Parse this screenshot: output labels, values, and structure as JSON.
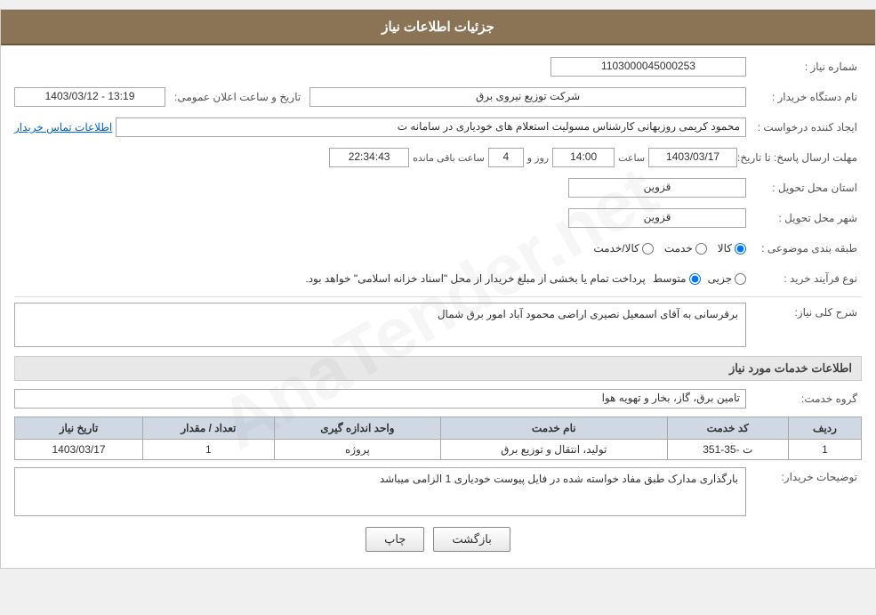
{
  "header": {
    "title": "جزئیات اطلاعات نیاز"
  },
  "form": {
    "need_number_label": "شماره نیاز :",
    "need_number_value": "1103000045000253",
    "requester_org_label": "نام دستگاه خریدار :",
    "requester_org_value": "شرکت توزیع نیروی برق",
    "announcement_date_label": "تاریخ و ساعت اعلان عمومی:",
    "announcement_date_value": "1403/03/12 - 13:19",
    "creator_label": "ایجاد کننده درخواست :",
    "creator_value": "محمود کریمی روزبهانی کارشناس  مسولیت استعلام های خودیاری در سامانه ت",
    "creator_contact_link": "اطلاعات تماس خریدار",
    "deadline_label": "مهلت ارسال پاسخ: تا تاریخ:",
    "deadline_date": "1403/03/17",
    "deadline_time_label": "ساعت",
    "deadline_time": "14:00",
    "deadline_days_label": "روز و",
    "deadline_days": "4",
    "deadline_remaining_label": "ساعت باقی مانده",
    "deadline_remaining": "22:34:43",
    "province_label": "استان محل تحویل :",
    "province_value": "قزوین",
    "city_label": "شهر محل تحویل :",
    "city_value": "قزوین",
    "subject_label": "طبقه بندی موضوعی :",
    "subject_options": [
      {
        "label": "کالا",
        "value": "kala"
      },
      {
        "label": "خدمت",
        "value": "khedmat"
      },
      {
        "label": "کالا/خدمت",
        "value": "kala_khedmat"
      }
    ],
    "subject_selected": "kala",
    "purchase_type_label": "نوع فرآیند خرید :",
    "purchase_type_options": [
      {
        "label": "جزیی",
        "value": "jozi"
      },
      {
        "label": "متوسط",
        "value": "motavaset"
      }
    ],
    "purchase_type_selected": "motavaset",
    "purchase_note": "پرداخت تمام یا بخشی از مبلغ خریدار از محل \"اسناد خزانه اسلامی\" خواهد بود.",
    "description_label": "شرح کلی نیاز:",
    "description_value": "برقرسانی به آقای اسمعیل نصیری اراضی محمود آباد امور برق شمال",
    "services_section_title": "اطلاعات خدمات مورد نیاز",
    "service_group_label": "گروه خدمت:",
    "service_group_value": "تامین برق، گاز، بخار و تهویه هوا",
    "table": {
      "columns": [
        "ردیف",
        "کد خدمت",
        "نام خدمت",
        "واحد اندازه گیری",
        "تعداد / مقدار",
        "تاریخ نیاز"
      ],
      "rows": [
        {
          "row": "1",
          "service_code": "ت -35-351",
          "service_name": "تولید، انتقال و توزیع برق",
          "unit": "پروژه",
          "quantity": "1",
          "date": "1403/03/17"
        }
      ]
    },
    "buyer_desc_label": "توضیحات خریدار:",
    "buyer_desc_value": "بارگذاری مدارک طبق مفاد خواسته شده در فایل پیوست خودیاری 1 الزامی میباشد"
  },
  "buttons": {
    "print_label": "چاپ",
    "back_label": "بازگشت"
  }
}
